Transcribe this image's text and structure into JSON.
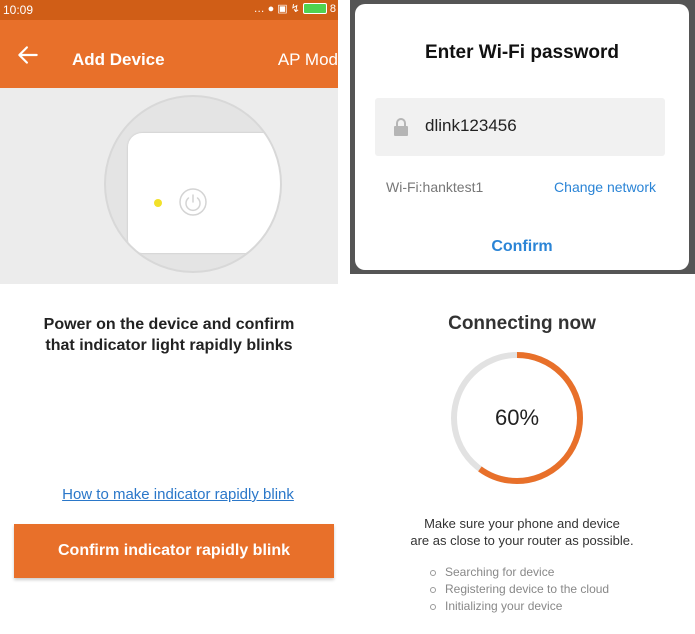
{
  "status_bar": {
    "time": "10:09",
    "battery_pct": "8"
  },
  "app_bar": {
    "title": "Add Device",
    "mode": "AP Mod"
  },
  "left": {
    "instruction_line1": "Power on the device and confirm",
    "instruction_line2": "that indicator light rapidly blinks",
    "help_link": "How to make indicator rapidly blink",
    "confirm_button": "Confirm indicator rapidly blink"
  },
  "dialog": {
    "title": "Enter Wi-Fi password",
    "password": "dlink123456",
    "wifi": "Wi-Fi:hanktest1",
    "change_network": "Change network",
    "confirm": "Confirm"
  },
  "connecting": {
    "title": "Connecting now",
    "progress": 60,
    "progress_label": "60%",
    "note_line1": "Make sure your phone and device",
    "note_line2": "are as close to your router as possible.",
    "steps": [
      "Searching for device",
      "Registering device to the cloud",
      "Initializing your device"
    ]
  },
  "colors": {
    "accent": "#e8702a",
    "link": "#2a84d6",
    "led": "#f2e12a"
  }
}
